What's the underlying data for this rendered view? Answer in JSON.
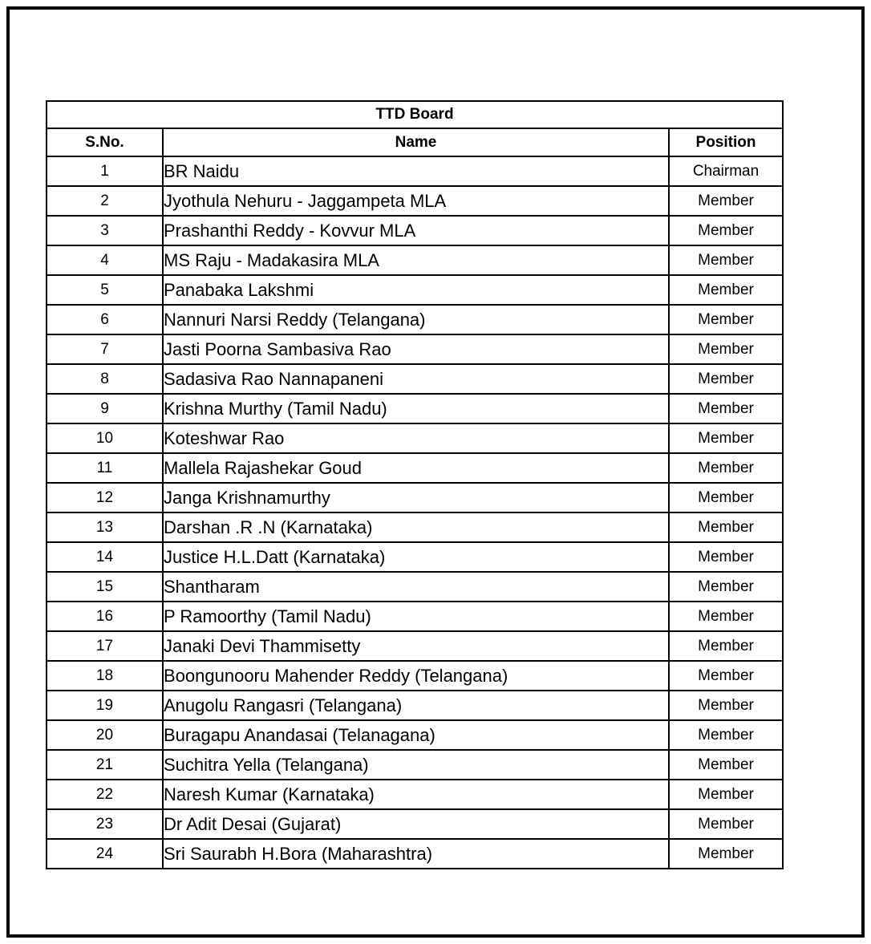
{
  "document": {
    "title": "TTD Board",
    "header_bg": "#F8E0CE",
    "border_color": "#000000",
    "text_color": "#000000"
  },
  "table": {
    "title": "TTD Board",
    "columns": [
      {
        "key": "sno",
        "label": "S.No."
      },
      {
        "key": "name",
        "label": "Name"
      },
      {
        "key": "pos",
        "label": "Position"
      }
    ],
    "rows": [
      {
        "sno": "1",
        "name": "BR Naidu",
        "pos": "Chairman"
      },
      {
        "sno": "2",
        "name": "Jyothula Nehuru - Jaggampeta MLA",
        "pos": "Member"
      },
      {
        "sno": "3",
        "name": "Prashanthi Reddy - Kovvur MLA",
        "pos": "Member"
      },
      {
        "sno": "4",
        "name": "MS Raju - Madakasira MLA",
        "pos": "Member"
      },
      {
        "sno": "5",
        "name": "Panabaka Lakshmi",
        "pos": "Member"
      },
      {
        "sno": "6",
        "name": "Nannuri Narsi Reddy (Telangana)",
        "pos": "Member"
      },
      {
        "sno": "7",
        "name": "Jasti Poorna Sambasiva Rao",
        "pos": "Member"
      },
      {
        "sno": "8",
        "name": "Sadasiva Rao Nannapaneni",
        "pos": "Member"
      },
      {
        "sno": "9",
        "name": "Krishna Murthy (Tamil Nadu)",
        "pos": "Member"
      },
      {
        "sno": "10",
        "name": "Koteshwar Rao",
        "pos": "Member"
      },
      {
        "sno": "11",
        "name": "Mallela Rajashekar Goud",
        "pos": "Member"
      },
      {
        "sno": "12",
        "name": "Janga Krishnamurthy",
        "pos": "Member"
      },
      {
        "sno": "13",
        "name": "Darshan .R .N (Karnataka)",
        "pos": "Member"
      },
      {
        "sno": "14",
        "name": "Justice H.L.Datt (Karnataka)",
        "pos": "Member"
      },
      {
        "sno": "15",
        "name": "Shantharam",
        "pos": "Member"
      },
      {
        "sno": "16",
        "name": "P Ramoorthy (Tamil Nadu)",
        "pos": "Member"
      },
      {
        "sno": "17",
        "name": "Janaki Devi Thammisetty",
        "pos": "Member"
      },
      {
        "sno": "18",
        "name": "Boongunooru Mahender Reddy (Telangana)",
        "pos": "Member"
      },
      {
        "sno": "19",
        "name": "Anugolu Rangasri (Telangana)",
        "pos": "Member"
      },
      {
        "sno": "20",
        "name": "Buragapu Anandasai (Telanagana)",
        "pos": "Member"
      },
      {
        "sno": "21",
        "name": "Suchitra Yella (Telangana)",
        "pos": "Member"
      },
      {
        "sno": "22",
        "name": "Naresh Kumar (Karnataka)",
        "pos": "Member"
      },
      {
        "sno": "23",
        "name": "Dr Adit Desai (Gujarat)",
        "pos": "Member"
      },
      {
        "sno": "24",
        "name": "Sri Saurabh H.Bora (Maharashtra)",
        "pos": "Member"
      }
    ]
  }
}
